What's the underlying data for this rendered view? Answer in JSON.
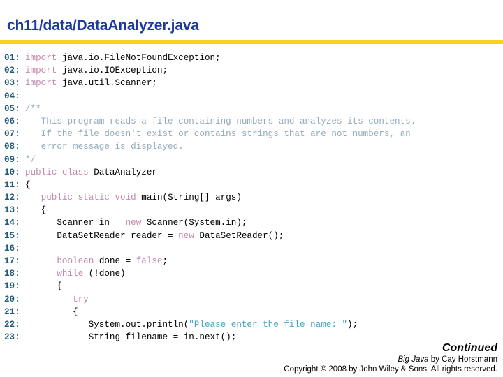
{
  "header": {
    "title": "ch11/data/DataAnalyzer.java",
    "rule_color": "#f6d320",
    "title_color": "#1c3a9e"
  },
  "colors": {
    "line_number": "#1f5a78",
    "keyword": "#c48aae",
    "comment": "#93aabb",
    "string": "#47a6c0",
    "identifier": "#000000"
  },
  "code": {
    "language": "java",
    "lines": [
      {
        "num": "01:",
        "tokens": [
          {
            "t": "import",
            "c": "kw"
          },
          {
            "t": " java.io.FileNotFoundException;",
            "c": "id"
          }
        ]
      },
      {
        "num": "02:",
        "tokens": [
          {
            "t": "import",
            "c": "kw"
          },
          {
            "t": " java.io.IOException;",
            "c": "id"
          }
        ]
      },
      {
        "num": "03:",
        "tokens": [
          {
            "t": "import",
            "c": "kw"
          },
          {
            "t": " java.util.Scanner;",
            "c": "id"
          }
        ]
      },
      {
        "num": "04:",
        "tokens": []
      },
      {
        "num": "05:",
        "tokens": [
          {
            "t": "/**",
            "c": "cmt"
          }
        ]
      },
      {
        "num": "06:",
        "tokens": [
          {
            "t": "   This program reads a file containing numbers and analyzes its contents.",
            "c": "cmt"
          }
        ]
      },
      {
        "num": "07:",
        "tokens": [
          {
            "t": "   If the file doesn't exist or contains strings that are not numbers, an",
            "c": "cmt"
          }
        ]
      },
      {
        "num": "08:",
        "tokens": [
          {
            "t": "   error message is displayed.",
            "c": "cmt"
          }
        ]
      },
      {
        "num": "09:",
        "tokens": [
          {
            "t": "*/",
            "c": "cmt"
          }
        ]
      },
      {
        "num": "10:",
        "tokens": [
          {
            "t": "public class",
            "c": "kw"
          },
          {
            "t": " DataAnalyzer",
            "c": "id"
          }
        ]
      },
      {
        "num": "11:",
        "tokens": [
          {
            "t": "{",
            "c": "id"
          }
        ]
      },
      {
        "num": "12:",
        "tokens": [
          {
            "t": "   ",
            "c": "id"
          },
          {
            "t": "public static void",
            "c": "kw"
          },
          {
            "t": " main(String[] args)",
            "c": "id"
          }
        ]
      },
      {
        "num": "13:",
        "tokens": [
          {
            "t": "   {",
            "c": "id"
          }
        ]
      },
      {
        "num": "14:",
        "tokens": [
          {
            "t": "      Scanner in = ",
            "c": "id"
          },
          {
            "t": "new",
            "c": "kw"
          },
          {
            "t": " Scanner(System.in);",
            "c": "id"
          }
        ]
      },
      {
        "num": "15:",
        "tokens": [
          {
            "t": "      DataSetReader reader = ",
            "c": "id"
          },
          {
            "t": "new",
            "c": "kw"
          },
          {
            "t": " DataSetReader();",
            "c": "id"
          }
        ]
      },
      {
        "num": "16:",
        "tokens": []
      },
      {
        "num": "17:",
        "tokens": [
          {
            "t": "      ",
            "c": "id"
          },
          {
            "t": "boolean",
            "c": "kw"
          },
          {
            "t": " done = ",
            "c": "id"
          },
          {
            "t": "false",
            "c": "kw"
          },
          {
            "t": ";",
            "c": "id"
          }
        ]
      },
      {
        "num": "18:",
        "tokens": [
          {
            "t": "      ",
            "c": "id"
          },
          {
            "t": "while",
            "c": "kw"
          },
          {
            "t": " (!done)",
            "c": "id"
          }
        ]
      },
      {
        "num": "19:",
        "tokens": [
          {
            "t": "      {",
            "c": "id"
          }
        ]
      },
      {
        "num": "20:",
        "tokens": [
          {
            "t": "         ",
            "c": "id"
          },
          {
            "t": "try",
            "c": "kw"
          }
        ]
      },
      {
        "num": "21:",
        "tokens": [
          {
            "t": "         {",
            "c": "id"
          }
        ]
      },
      {
        "num": "22:",
        "tokens": [
          {
            "t": "            System.out.println(",
            "c": "id"
          },
          {
            "t": "\"Please enter the file name: \"",
            "c": "str"
          },
          {
            "t": ");",
            "c": "id"
          }
        ]
      },
      {
        "num": "23:",
        "tokens": [
          {
            "t": "            String filename = in.next();",
            "c": "id"
          }
        ]
      }
    ]
  },
  "footer": {
    "continued": "Continued",
    "book_title": "Big Java",
    "credit_rest": " by Cay Horstmann",
    "copyright": "Copyright © 2008 by John Wiley & Sons.  All rights reserved."
  }
}
